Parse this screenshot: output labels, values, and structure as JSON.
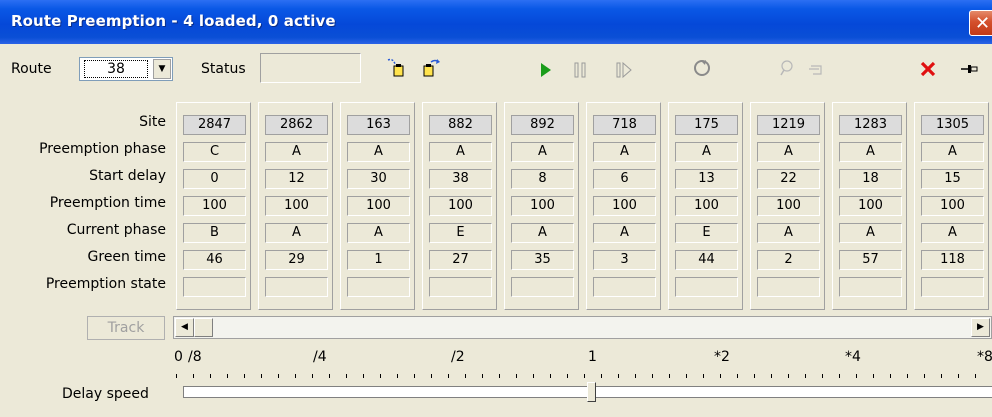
{
  "window": {
    "title": "Route Preemption - 4 loaded, 0 active",
    "close_glyph": "✕"
  },
  "toolbar": {
    "route_label": "Route",
    "route_value": "38",
    "status_label": "Status",
    "status_value": "",
    "icons": [
      "load-route-icon",
      "export-route-icon",
      "play-icon",
      "pause-icon",
      "step-icon",
      "refresh-icon",
      "find-icon",
      "pointer-icon",
      "delete-icon",
      "pin-icon"
    ]
  },
  "grid": {
    "row_labels": [
      "Site",
      "Preemption phase",
      "Start delay",
      "Preemption time",
      "Current phase",
      "Green time",
      "Preemption state"
    ],
    "columns": [
      {
        "site": "2847",
        "preemption_phase": "C",
        "start_delay": "0",
        "preemption_time": "100",
        "current_phase": "B",
        "green_time": "46",
        "preemption_state": ""
      },
      {
        "site": "2862",
        "preemption_phase": "A",
        "start_delay": "12",
        "preemption_time": "100",
        "current_phase": "A",
        "green_time": "29",
        "preemption_state": ""
      },
      {
        "site": "163",
        "preemption_phase": "A",
        "start_delay": "30",
        "preemption_time": "100",
        "current_phase": "A",
        "green_time": "1",
        "preemption_state": ""
      },
      {
        "site": "882",
        "preemption_phase": "A",
        "start_delay": "38",
        "preemption_time": "100",
        "current_phase": "E",
        "green_time": "27",
        "preemption_state": ""
      },
      {
        "site": "892",
        "preemption_phase": "A",
        "start_delay": "8",
        "preemption_time": "100",
        "current_phase": "A",
        "green_time": "35",
        "preemption_state": ""
      },
      {
        "site": "718",
        "preemption_phase": "A",
        "start_delay": "6",
        "preemption_time": "100",
        "current_phase": "A",
        "green_time": "3",
        "preemption_state": ""
      },
      {
        "site": "175",
        "preemption_phase": "A",
        "start_delay": "13",
        "preemption_time": "100",
        "current_phase": "E",
        "green_time": "44",
        "preemption_state": ""
      },
      {
        "site": "1219",
        "preemption_phase": "A",
        "start_delay": "22",
        "preemption_time": "100",
        "current_phase": "A",
        "green_time": "2",
        "preemption_state": ""
      },
      {
        "site": "1283",
        "preemption_phase": "A",
        "start_delay": "18",
        "preemption_time": "100",
        "current_phase": "A",
        "green_time": "57",
        "preemption_state": ""
      },
      {
        "site": "1305",
        "preemption_phase": "A",
        "start_delay": "15",
        "preemption_time": "100",
        "current_phase": "A",
        "green_time": "118",
        "preemption_state": ""
      }
    ]
  },
  "track_button": "Track",
  "delay_speed": {
    "label": "Delay speed",
    "scale_labels": [
      "0",
      "/8",
      "/4",
      "/2",
      "1",
      "*2",
      "*4",
      "*8"
    ],
    "value_label": "1"
  },
  "colors": {
    "title_bar": "#0a58e6",
    "play": "#1a9c1a",
    "delete": "#e01010"
  }
}
